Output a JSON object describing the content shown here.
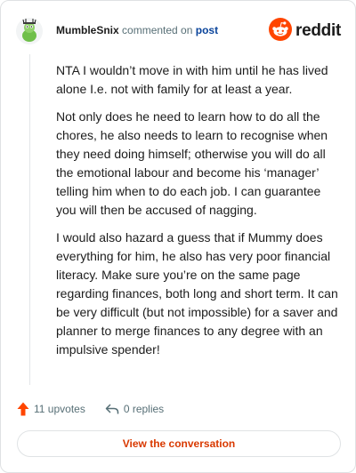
{
  "comment": {
    "author": "MumbleSnix",
    "action_text": "commented on",
    "post_link_text": "post",
    "paragraphs": [
      "NTA I wouldn’t move in with him until he has lived alone I.e. not with family for at least a year.",
      "Not only does he need to learn how to do all the chores, he also needs to learn to recognise when they need doing himself; otherwise you will do all the emotional labour and become his ‘manager’ telling him when to do each job. I can guarantee you will then be accused of nagging.",
      "I would also hazard a guess that if Mummy does everything for him, he also has very poor financial literacy. Make sure you’re on the same page regarding finances, both long and short term. It can be very difficult (but not impossible) for a saver and planner to merge finances to any degree with an impulsive spender!"
    ]
  },
  "brand": {
    "wordmark": "reddit",
    "icon": "reddit-logo-icon",
    "color": "#ff4500"
  },
  "footer": {
    "upvotes_label": "11 upvotes",
    "replies_label": "0 replies",
    "upvote_icon": "upvote-arrow-icon",
    "reply_icon": "reply-arrow-icon",
    "upvote_color": "#ff4500"
  },
  "cta": {
    "label": "View the conversation",
    "color": "#d93900"
  }
}
